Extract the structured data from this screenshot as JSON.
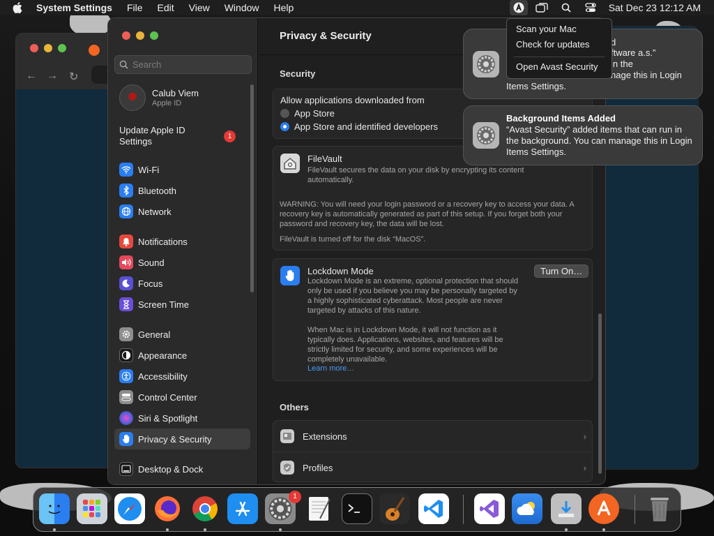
{
  "menubar": {
    "app_name": "System Settings",
    "items": [
      "File",
      "Edit",
      "View",
      "Window",
      "Help"
    ],
    "clock": "Sat Dec 23  12:12 AM"
  },
  "search": {
    "placeholder": "Search"
  },
  "account": {
    "name": "Calub Viem",
    "subtitle": "Apple ID"
  },
  "update": {
    "label": "Update Apple ID Settings",
    "badge": "1"
  },
  "sidebar": {
    "items": [
      {
        "label": "Wi-Fi",
        "icon": "wifi-icon",
        "color": "#2a7ef0"
      },
      {
        "label": "Bluetooth",
        "icon": "bluetooth-icon",
        "color": "#2a7ef0"
      },
      {
        "label": "Network",
        "icon": "globe-icon",
        "color": "#2a7ef0"
      },
      {
        "label": "Notifications",
        "icon": "bell-icon",
        "color": "#e5483d"
      },
      {
        "label": "Sound",
        "icon": "speaker-icon",
        "color": "#e5485c"
      },
      {
        "label": "Focus",
        "icon": "moon-icon",
        "color": "#5b4fd6"
      },
      {
        "label": "Screen Time",
        "icon": "hourglass-icon",
        "color": "#6a4fd6"
      },
      {
        "label": "General",
        "icon": "gear-icon",
        "color": "#8e8e8e"
      },
      {
        "label": "Appearance",
        "icon": "appearance-icon",
        "color": "#1a1a1a"
      },
      {
        "label": "Accessibility",
        "icon": "accessibility-icon",
        "color": "#2a7ef0"
      },
      {
        "label": "Control Center",
        "icon": "control-center-icon",
        "color": "#8e8e8e"
      },
      {
        "label": "Siri & Spotlight",
        "icon": "siri-icon",
        "color": "#b04fd6"
      },
      {
        "label": "Privacy & Security",
        "icon": "hand-icon",
        "color": "#2a7ef0"
      },
      {
        "label": "Desktop & Dock",
        "icon": "dock-icon",
        "color": "#1a1a1a"
      }
    ]
  },
  "content": {
    "title": "Privacy & Security",
    "security_heading": "Security",
    "allow_label": "Allow applications downloaded from",
    "radio_app_store": "App Store",
    "radio_identified": "App Store and identified developers",
    "filevault": {
      "title": "FileVault",
      "desc": "FileVault secures the data on your disk by encrypting its content automatically.",
      "warning": "WARNING: You will need your login password or a recovery key to access your data. A recovery key is automatically generated as part of this setup. If you forget both your password and recovery key, the data will be lost.",
      "status": "FileVault is turned off for the disk “MacOS”."
    },
    "lockdown": {
      "title": "Lockdown Mode",
      "button": "Turn On…",
      "desc": "Lockdown Mode is an extreme, optional protection that should only be used if you believe you may be personally targeted by a highly sophisticated cyberattack. Most people are never targeted by attacks of this nature.",
      "desc2": "When Mac is in Lockdown Mode, it will not function as it typically does. Applications, websites, and features will be strictly limited for security, and some experiences will be completely unavailable.",
      "link": "Learn more…"
    },
    "others_heading": "Others",
    "extensions": "Extensions",
    "profiles": "Profiles"
  },
  "avast_menu": {
    "items": [
      "Scan your Mac",
      "Check for updates",
      "Open Avast Security"
    ]
  },
  "notif1": {
    "line1": "d",
    "line2": "ftware a.s.”",
    "line3": "in the",
    "line4": "nage this in Login",
    "line5": "Items Settings."
  },
  "notif2": {
    "title": "Background Items Added",
    "body": "“Avast Security” added items that can run in the background. You can manage this in Login Items Settings."
  },
  "dock": {
    "settings_badge": "1",
    "apps": [
      "Finder",
      "Launchpad",
      "Safari",
      "Firefox",
      "Chrome",
      "App Store",
      "System Settings",
      "TextEdit",
      "Terminal",
      "GarageBand",
      "VS Code",
      "Visual Studio",
      "Weather",
      "Downloads",
      "Avast",
      "Trash"
    ]
  }
}
